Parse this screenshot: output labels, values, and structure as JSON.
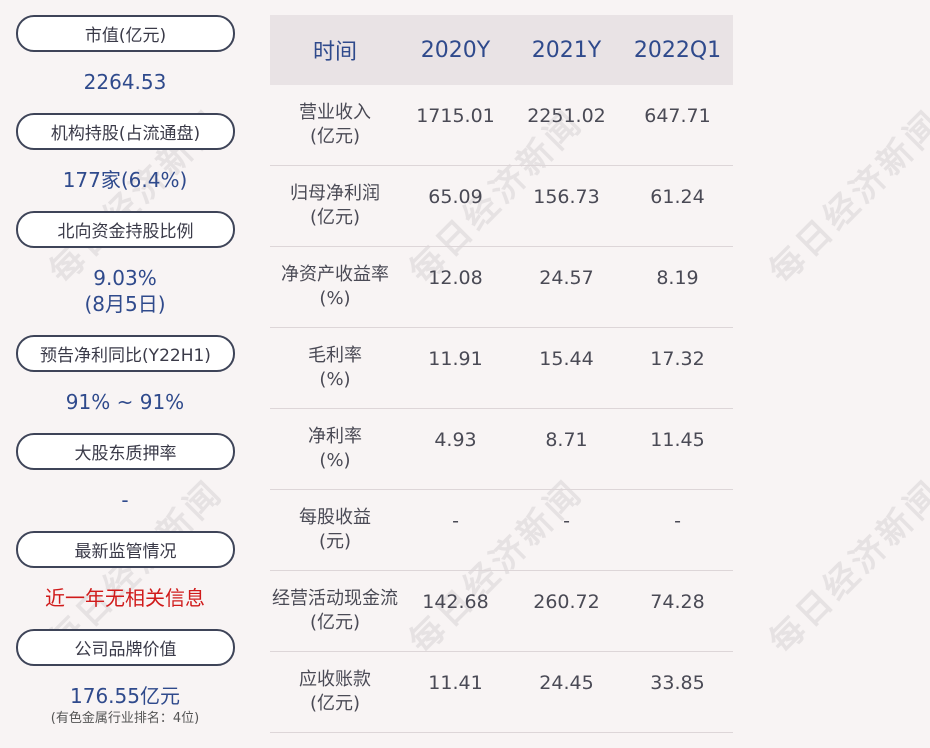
{
  "left_panel": [
    {
      "label": "市值(亿元)",
      "value": "2264.53"
    },
    {
      "label": "机构持股(占流通盘)",
      "value": "177家(6.4%)"
    },
    {
      "label": "北向资金持股比例",
      "value": "9.03%",
      "value2": "(8月5日)"
    },
    {
      "label": "预告净利同比(Y22H1)",
      "value": "91% ~ 91%"
    },
    {
      "label": "大股东质押率",
      "value": "-"
    },
    {
      "label": "最新监管情况",
      "value": "近一年无相关信息"
    },
    {
      "label": "公司品牌价值",
      "value": "176.55亿元",
      "note": "(有色金属行业排名：4位)"
    }
  ],
  "table": {
    "headers": [
      "时间",
      "2020Y",
      "2021Y",
      "2022Q1"
    ],
    "rows": [
      {
        "label1": "营业收入",
        "label2": "(亿元)",
        "values": [
          "1715.01",
          "2251.02",
          "647.71"
        ]
      },
      {
        "label1": "归母净利润",
        "label2": "(亿元)",
        "values": [
          "65.09",
          "156.73",
          "61.24"
        ]
      },
      {
        "label1": "净资产收益率",
        "label2": "(%)",
        "values": [
          "12.08",
          "24.57",
          "8.19"
        ]
      },
      {
        "label1": "毛利率",
        "label2": "(%)",
        "values": [
          "11.91",
          "15.44",
          "17.32"
        ]
      },
      {
        "label1": "净利率",
        "label2": "(%)",
        "values": [
          "4.93",
          "8.71",
          "11.45"
        ]
      },
      {
        "label1": "每股收益",
        "label2": "(元)",
        "values": [
          "-",
          "-",
          "-"
        ]
      },
      {
        "label1": "经营活动现金流",
        "label2": "(亿元)",
        "values": [
          "142.68",
          "260.72",
          "74.28"
        ]
      },
      {
        "label1": "应收账款",
        "label2": "(亿元)",
        "values": [
          "11.41",
          "24.45",
          "33.85"
        ]
      }
    ]
  },
  "watermark": "每日经济新闻"
}
